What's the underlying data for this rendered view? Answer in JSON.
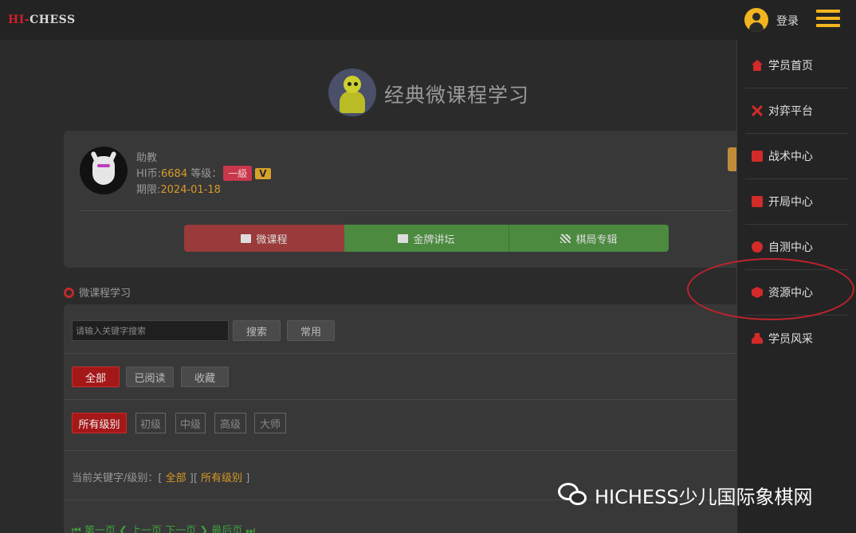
{
  "header": {
    "logo_hi": "HI-",
    "logo_chess": "CHESS",
    "login_label": "登录"
  },
  "page_title": "经典微课程学习",
  "profile": {
    "role": "助教",
    "coins_label": "HI币:",
    "coins_value": "6684",
    "level_label": " 等级：",
    "level_value": "一級",
    "vip_badge": "V",
    "expiry_label": "期限:",
    "expiry_value": "2024-01-18"
  },
  "category_tabs": [
    {
      "label": "微课程",
      "icon": "cube-icon"
    },
    {
      "label": "金牌讲坛",
      "icon": "image-icon"
    },
    {
      "label": "棋局专辑",
      "icon": "grid-icon"
    }
  ],
  "section_title": "微课程学习",
  "search": {
    "placeholder": "请输入关键字搜索",
    "search_button": "搜索",
    "common_button": "常用"
  },
  "read_filters": [
    "全部",
    "已阅读",
    "收藏"
  ],
  "level_filters": [
    "所有级别",
    "初级",
    "中级",
    "高级",
    "大师"
  ],
  "current_filter": {
    "prefix": "当前关键字/级别：[",
    "keyword": "全部",
    "mid": "][",
    "level": "所有级别",
    "suffix": "]"
  },
  "pager_text": "⏮ 第一页 ❮ 上一页  下一页 ❯  最后页 ⏭",
  "side_menu": [
    {
      "label": "学员首页",
      "icon": "house-icon"
    },
    {
      "label": "对弈平台",
      "icon": "crossed-swords-icon"
    },
    {
      "label": "战术中心",
      "icon": "tactics-icon"
    },
    {
      "label": "开局中心",
      "icon": "opening-icon"
    },
    {
      "label": "自测中心",
      "icon": "test-icon"
    },
    {
      "label": "资源中心",
      "icon": "cube-icon"
    },
    {
      "label": "学员风采",
      "icon": "student-icon"
    }
  ],
  "watermark": "HICHESS少儿国际象棋网",
  "colors": {
    "accent_yellow": "#f2b51f",
    "accent_red": "#a51818",
    "accent_green": "#4b8a3f",
    "highlight_orange": "#d79a2a"
  }
}
